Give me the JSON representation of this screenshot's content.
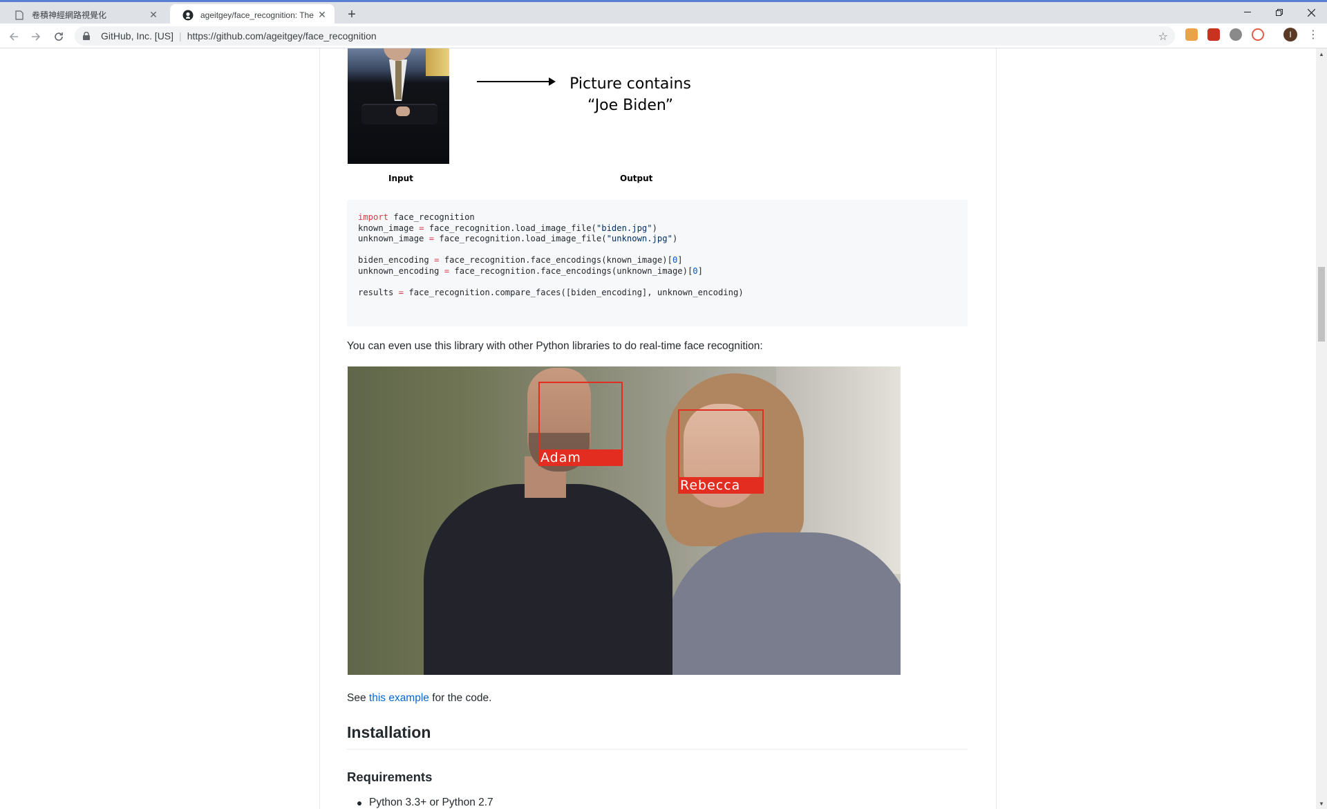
{
  "browser": {
    "tabs": [
      {
        "title": "卷積神經網路視覺化",
        "active": false
      },
      {
        "title": "ageitgey/face_recognition: The",
        "active": true
      }
    ],
    "site_identity": "GitHub, Inc. [US]",
    "url": "https://github.com/ageitgey/face_recognition",
    "profile_initial": "I",
    "window_controls": [
      "minimize",
      "restore",
      "close"
    ],
    "extension_colors": [
      "#d2691e",
      "#c8321e",
      "#8a8a8a",
      "#e25b4a"
    ]
  },
  "figure": {
    "output_line1": "Picture contains",
    "output_line2": "“Joe Biden”",
    "input_caption": "Input",
    "output_caption": "Output"
  },
  "code": {
    "lines": [
      [
        {
          "t": "import",
          "c": "kw"
        },
        {
          "t": " face_recognition"
        }
      ],
      [
        {
          "t": "known_image "
        },
        {
          "t": "=",
          "c": "op"
        },
        {
          "t": " face_recognition.load_image_file("
        },
        {
          "t": "\"biden.jpg\"",
          "c": "str"
        },
        {
          "t": ")"
        }
      ],
      [
        {
          "t": "unknown_image "
        },
        {
          "t": "=",
          "c": "op"
        },
        {
          "t": " face_recognition.load_image_file("
        },
        {
          "t": "\"unknown.jpg\"",
          "c": "str"
        },
        {
          "t": ")"
        }
      ],
      [],
      [
        {
          "t": "biden_encoding "
        },
        {
          "t": "=",
          "c": "op"
        },
        {
          "t": " face_recognition.face_encodings(known_image)["
        },
        {
          "t": "0",
          "c": "num"
        },
        {
          "t": "]"
        }
      ],
      [
        {
          "t": "unknown_encoding "
        },
        {
          "t": "=",
          "c": "op"
        },
        {
          "t": " face_recognition.face_encodings(unknown_image)["
        },
        {
          "t": "0",
          "c": "num"
        },
        {
          "t": "]"
        }
      ],
      [],
      [
        {
          "t": "results "
        },
        {
          "t": "=",
          "c": "op"
        },
        {
          "t": " face_recognition.compare_faces([biden_encoding], unknown_encoding)"
        }
      ]
    ]
  },
  "text": {
    "realtime_intro": "You can even use this library with other Python libraries to do real-time face recognition:",
    "see_prefix": "See ",
    "see_link": "this example",
    "see_suffix": " for the code.",
    "installation_heading": "Installation",
    "requirements_heading": "Requirements",
    "requirement_1": "Python 3.3+ or Python 2.7"
  },
  "faces": {
    "adam": "Adam",
    "rebecca": "Rebecca",
    "box_color": "#e32d20"
  }
}
